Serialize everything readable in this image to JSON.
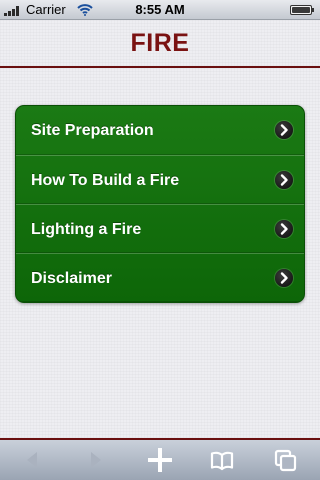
{
  "status_bar": {
    "carrier": "Carrier",
    "time": "8:55 AM",
    "battery_level": 1.0
  },
  "header": {
    "title": "FIRE"
  },
  "menu": {
    "items": [
      {
        "label": "Site Preparation",
        "icon": "chevron-right-icon"
      },
      {
        "label": "How To Build a Fire",
        "icon": "chevron-right-icon"
      },
      {
        "label": "Lighting a Fire",
        "icon": "chevron-right-icon"
      },
      {
        "label": "Disclaimer",
        "icon": "chevron-right-icon"
      }
    ]
  },
  "toolbar": {
    "buttons": [
      {
        "name": "back",
        "icon": "back-arrow-icon",
        "enabled": false
      },
      {
        "name": "forward",
        "icon": "forward-arrow-icon",
        "enabled": false
      },
      {
        "name": "add",
        "icon": "plus-icon",
        "enabled": true
      },
      {
        "name": "bookmarks",
        "icon": "book-icon",
        "enabled": true
      },
      {
        "name": "pages",
        "icon": "pages-icon",
        "enabled": true
      }
    ]
  },
  "colors": {
    "title": "#7a1212",
    "menu_green": "#157010",
    "header_rule": "#6a1010"
  }
}
